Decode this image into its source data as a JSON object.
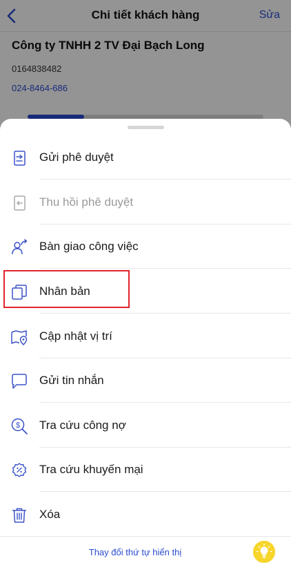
{
  "background": {
    "nav": {
      "title": "Chi tiết khách hàng",
      "edit_label": "Sửa"
    },
    "customer": {
      "name": "Công ty TNHH 2 TV Đại Bạch Long",
      "code": "0164838482",
      "phone": "024-8464-686"
    }
  },
  "sheet": {
    "items": [
      {
        "label": "Gửi phê duyệt",
        "icon": "send-approval-icon",
        "enabled": true
      },
      {
        "label": "Thu hồi phê duyệt",
        "icon": "revoke-approval-icon",
        "enabled": false
      },
      {
        "label": "Bàn giao công việc",
        "icon": "handover-icon",
        "enabled": true
      },
      {
        "label": "Nhân bản",
        "icon": "duplicate-icon",
        "enabled": true
      },
      {
        "label": "Cập nhật vị trí",
        "icon": "map-pin-icon",
        "enabled": true
      },
      {
        "label": "Gửi tin nhắn",
        "icon": "message-icon",
        "enabled": true
      },
      {
        "label": "Tra cứu công nợ",
        "icon": "debt-search-icon",
        "enabled": true
      },
      {
        "label": "Tra cứu khuyến mại",
        "icon": "promotion-icon",
        "enabled": true
      },
      {
        "label": "Xóa",
        "icon": "trash-icon",
        "enabled": true
      }
    ],
    "footer_link": "Thay đổi thứ tự hiển thị",
    "footer_icon": "lightbulb-icon"
  },
  "colors": {
    "accent": "#2a4bd0",
    "highlight": "#e0232c",
    "icon": "#3a52c8",
    "bulb": "#f7d52a"
  }
}
